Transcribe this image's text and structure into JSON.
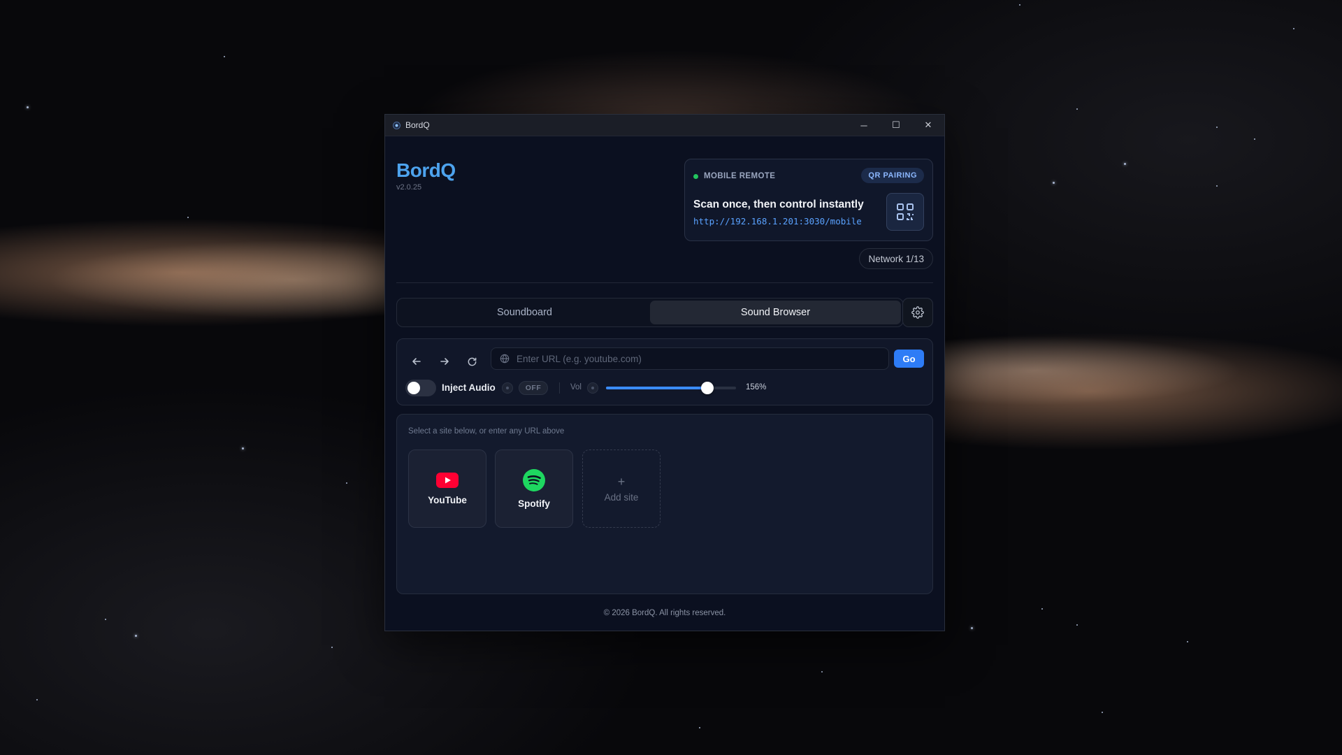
{
  "window": {
    "title": "BordQ",
    "controls": {
      "minimize": "─",
      "maximize": "☐",
      "close": "✕"
    }
  },
  "brand": {
    "name": "BordQ",
    "version": "v2.0.25",
    "color": "#4da3ee"
  },
  "remote": {
    "label": "MOBILE REMOTE",
    "status_color": "#22c55e",
    "badge": "QR PAIRING",
    "headline": "Scan once, then control instantly",
    "url": "http://192.168.1.201:3030/mobile",
    "qr_icon": "qr-code-icon"
  },
  "network": {
    "label": "Network 1/13"
  },
  "tabs": [
    {
      "label": "Soundboard",
      "active": false
    },
    {
      "label": "Sound Browser",
      "active": true
    }
  ],
  "settings": {
    "icon": "gear-icon"
  },
  "browser": {
    "back_icon": "arrow-left-icon",
    "forward_icon": "arrow-right-icon",
    "reload_icon": "reload-icon",
    "url_value": "",
    "url_placeholder": "Enter URL (e.g. youtube.com)",
    "go_label": "Go",
    "accent": "#2e7cf6"
  },
  "audio": {
    "inject_label": "Inject Audio",
    "inject_enabled": false,
    "off_label": "OFF",
    "vol_label": "Vol",
    "volume_percent": 156,
    "volume_max_percent": 200,
    "volume_text": "156%"
  },
  "sites": {
    "hint": "Select a site below, or enter any URL above",
    "items": [
      {
        "label": "YouTube",
        "icon": "youtube-icon",
        "color": "#ff0033"
      },
      {
        "label": "Spotify",
        "icon": "spotify-icon",
        "color": "#1ed760"
      }
    ],
    "add_label": "Add site",
    "add_symbol": "+"
  },
  "footer": {
    "text": "© 2026 BordQ. All rights reserved."
  }
}
